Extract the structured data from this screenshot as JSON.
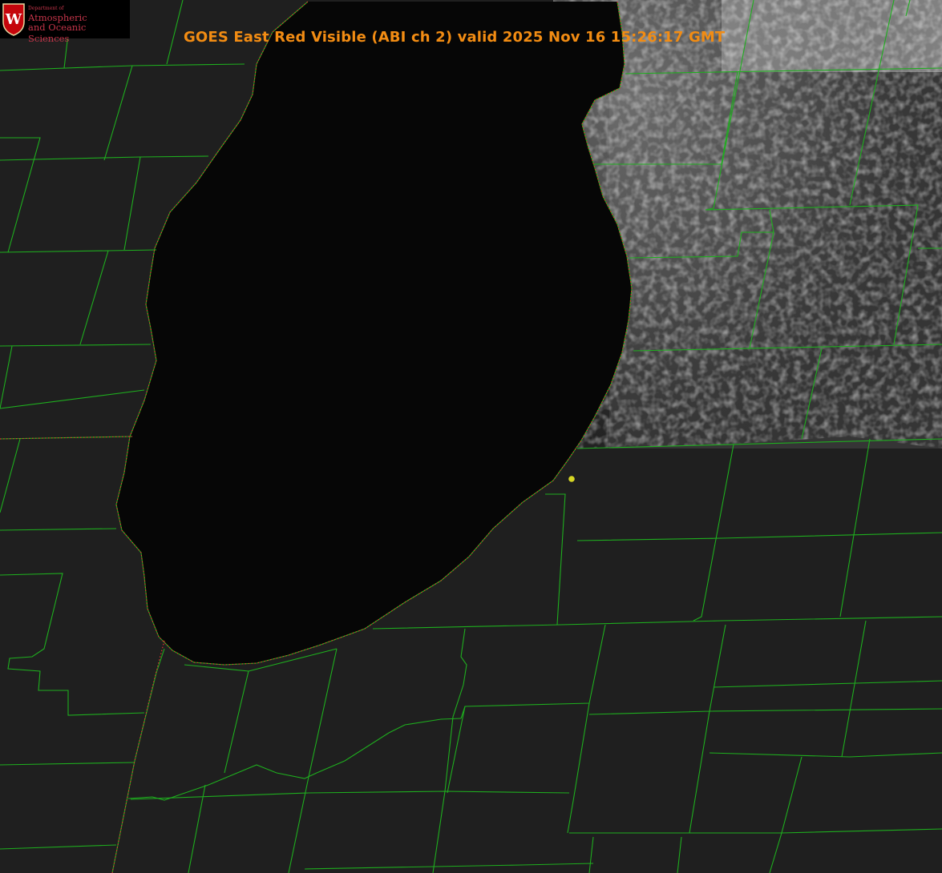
{
  "header": {
    "title": "GOES East Red Visible (ABI ch 2) valid 2025 Nov 16 15:26:17 GMT",
    "title_color": "#f28c13"
  },
  "logo": {
    "crest_letter": "W",
    "dept_line": "Department of",
    "line1": "Atmospheric",
    "line2": "and Oceanic Sciences",
    "color": "#c6354a"
  },
  "map": {
    "imagery": "satellite-visible",
    "lake": "lake-michigan-southern-basin",
    "border_color": "#1fae1f",
    "state_line_color": "#e0332f",
    "marker_color": "#d6d624",
    "marker_icon": "location-dot-icon"
  }
}
